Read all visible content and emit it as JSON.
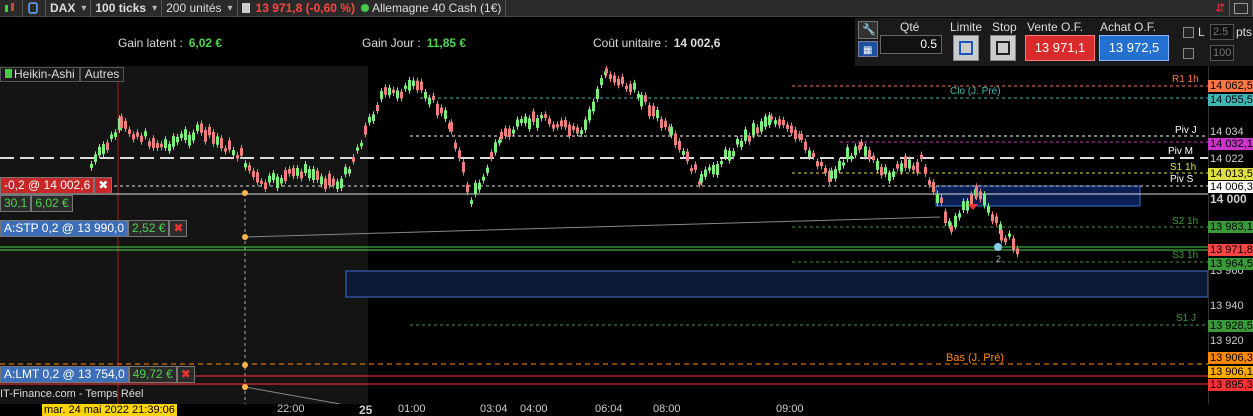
{
  "toolbar": {
    "symbol": "DAX",
    "period": "100 ticks",
    "units": "200 unités",
    "quote": "13 971,8 (-0,60 %)",
    "instrument": "Allemagne 40 Cash (1€)"
  },
  "info": {
    "latent_label": "Gain latent :",
    "latent_value": "6,02 €",
    "day_label": "Gain Jour :",
    "day_value": "11,85 €",
    "cost_label": "Coût unitaire :",
    "cost_value": "14 002,6"
  },
  "order_panel": {
    "qty_label": "Qté",
    "qty_value": "0.5",
    "limit_label": "Limite",
    "stop_label": "Stop",
    "sell_label": "Vente O.F.",
    "sell_price": "13 971,1",
    "buy_label": "Achat O.F.",
    "buy_price": "13 972,5",
    "l_label": "L",
    "l_value": "2.5",
    "pts_label": "pts",
    "box2_value": "100"
  },
  "chart_tabs": [
    "Heikin-Ashi",
    "Autres"
  ],
  "order_tags": {
    "position": {
      "qty": "-0,2 @ 14 002,6",
      "close": "✖"
    },
    "gain": {
      "a": "30,1",
      "b": "6,02 €"
    },
    "stop": {
      "label": "A:STP  0,2 @ 13 990,0",
      "gain": "2,52 €",
      "close": "✖"
    },
    "limit": {
      "label": "A:LMT  0,2 @ 13 754,0",
      "gain": "49,72 €",
      "close": "✖"
    }
  },
  "price_scale": {
    "ticks": [
      "14 034",
      "14 022",
      "14 000",
      "13 960",
      "13 940",
      "13 920"
    ],
    "tags": [
      {
        "text": "14 062,5",
        "color": "#ff7744"
      },
      {
        "text": "14 055,5",
        "color": "#3fb6b6"
      },
      {
        "text": "14 032,1",
        "color": "#cc33cc"
      },
      {
        "text": "14 013,5",
        "color": "#e0e040"
      },
      {
        "text": "14 006,3",
        "color": "#ffffff"
      },
      {
        "text": "13 983,1",
        "color": "#3a9a3a"
      },
      {
        "text": "13 971,8",
        "color": "#ff4444"
      },
      {
        "text": "13 964,5",
        "color": "#3a9a3a"
      },
      {
        "text": "13 928,5",
        "color": "#3a9a3a"
      },
      {
        "text": "13 906,3",
        "color": "#ff8800"
      },
      {
        "text": "13 906,1",
        "color": "#ffaa00"
      },
      {
        "text": "13 895,3",
        "color": "#ff3333"
      }
    ]
  },
  "levels": [
    {
      "name": "R1 1h",
      "color": "#ff7744"
    },
    {
      "name": "Clo (J. Pré)",
      "color": "#3fb6b6"
    },
    {
      "name": "Piv J",
      "color": "#ffffff"
    },
    {
      "name": "Piv M",
      "color": "#ffffff"
    },
    {
      "name": "S1 1h",
      "color": "#e0e040"
    },
    {
      "name": "Piv S",
      "color": "#ffffff"
    },
    {
      "name": "S2 1h",
      "color": "#3a9a3a"
    },
    {
      "name": "S3 1h",
      "color": "#3a9a3a"
    },
    {
      "name": "S1 J",
      "color": "#3a9a3a"
    },
    {
      "name": "Bas (J. Pré)",
      "color": "#ff8800"
    }
  ],
  "time_axis": {
    "date": "mar. 24 mai 2022 21:39:06",
    "ticks": [
      "22:00",
      "25",
      "01:00",
      "03:04",
      "04:00",
      "06:04",
      "08:00",
      "09:00"
    ]
  },
  "source": "IT-Finance.com - Temps Réel",
  "marker_label": "2",
  "colors": {
    "up": "#7cf07c",
    "down": "#f08080",
    "sell": "#d92b2b",
    "buy": "#2470d1"
  }
}
